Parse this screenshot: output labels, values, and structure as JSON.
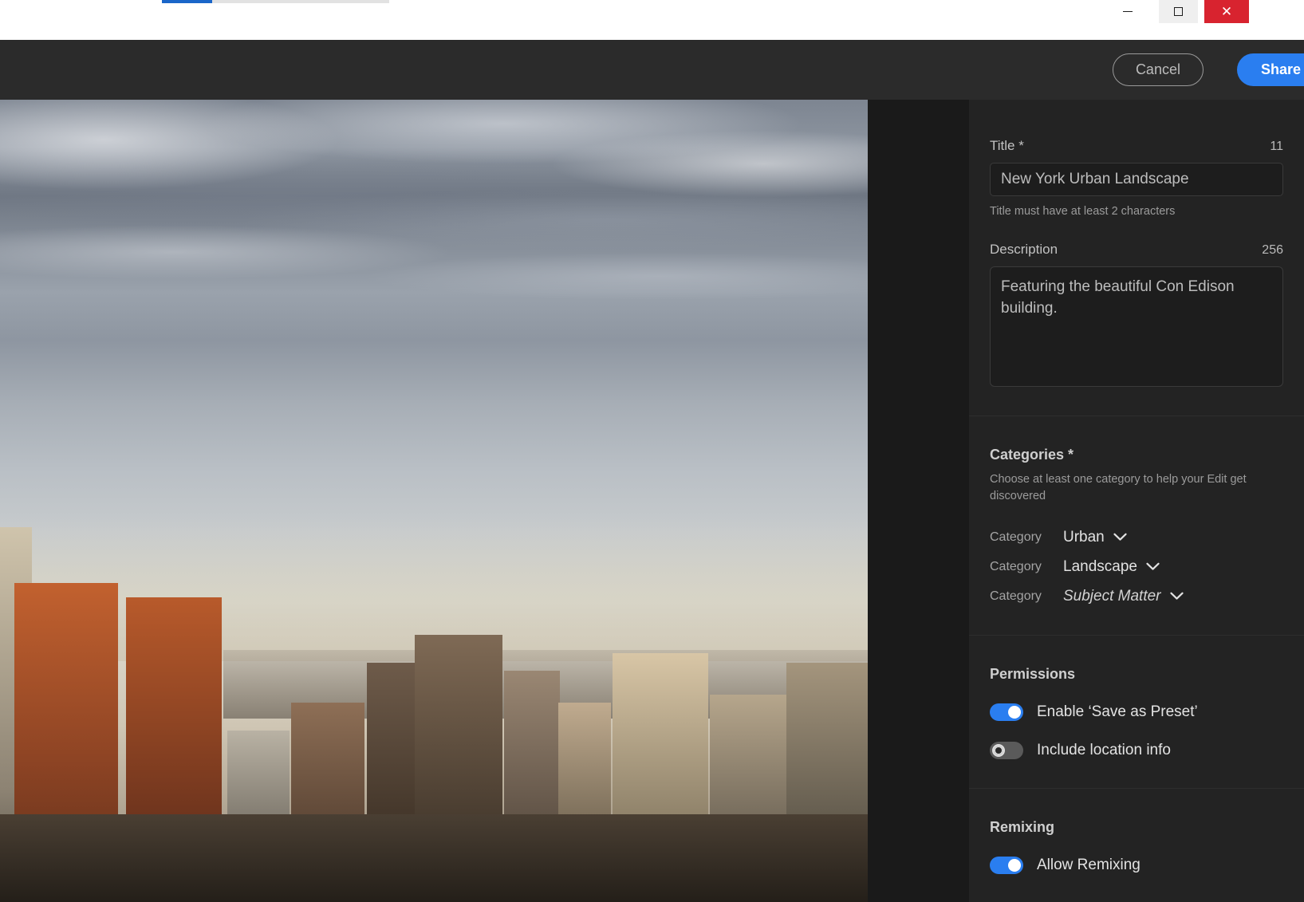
{
  "window": {
    "minimize_icon": "minimize-icon",
    "restore_icon": "restore-icon",
    "close_icon": "close-icon",
    "progress_percent": 22
  },
  "toolbar": {
    "cancel_label": "Cancel",
    "share_label": "Share"
  },
  "panel": {
    "title_field": {
      "label": "Title *",
      "counter": "11",
      "value": "New York Urban Landscape",
      "help": "Title must have at least 2 characters"
    },
    "description_field": {
      "label": "Description",
      "counter": "256",
      "value": "Featuring the beautiful Con Edison building."
    },
    "categories": {
      "title": "Categories *",
      "subtitle": "Choose at least one category to help your Edit get discovered",
      "rows": [
        {
          "key": "Category",
          "value": "Urban",
          "placeholder": false
        },
        {
          "key": "Category",
          "value": "Landscape",
          "placeholder": false
        },
        {
          "key": "Category",
          "value": "Subject Matter",
          "placeholder": true
        }
      ]
    },
    "permissions": {
      "title": "Permissions",
      "toggles": [
        {
          "label": "Enable ‘Save as Preset’",
          "on": true
        },
        {
          "label": "Include location info",
          "on": false
        }
      ]
    },
    "remixing": {
      "title": "Remixing",
      "toggles": [
        {
          "label": "Allow Remixing",
          "on": true
        }
      ]
    }
  },
  "colors": {
    "accent": "#2a7ef0",
    "close": "#d8232f",
    "panel_bg": "#232323",
    "canvas_bg": "#1a1a1a",
    "toolbar_bg": "#2b2b2b"
  },
  "preview": {
    "alt": "New York city skyline photo at golden hour"
  }
}
